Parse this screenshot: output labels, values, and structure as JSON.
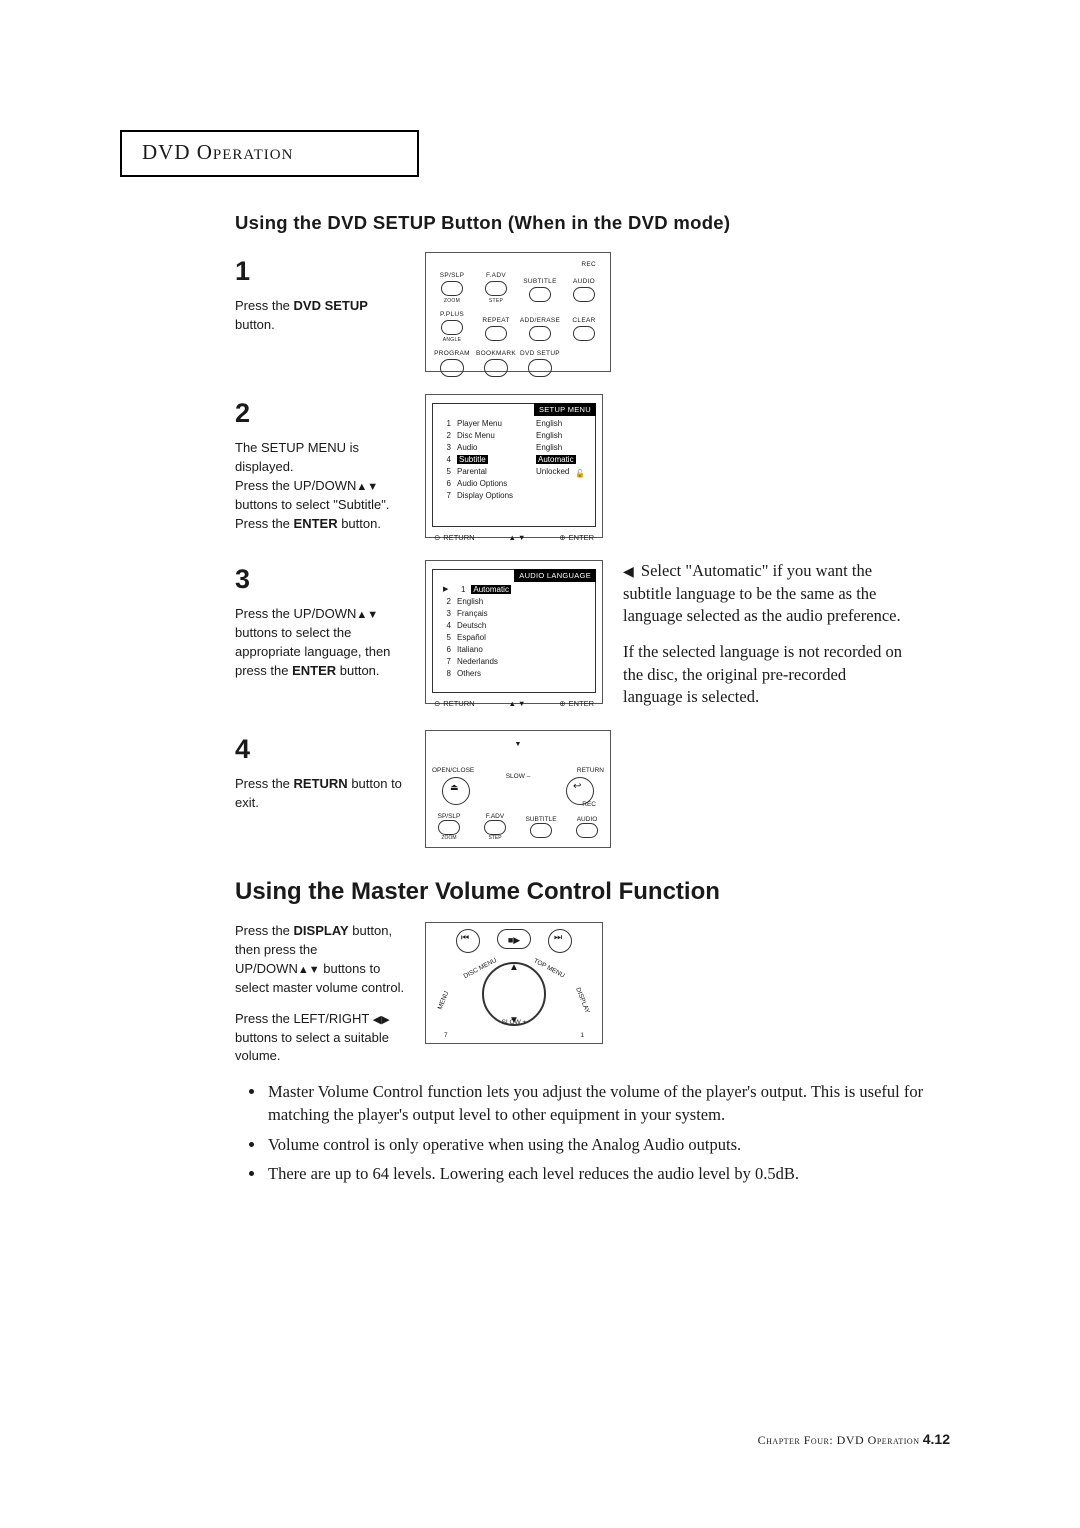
{
  "header": "DVD Operation",
  "section1_title": "Using the DVD SETUP Button (When in the DVD mode)",
  "step1": {
    "num": "1",
    "text_pre": "Press the ",
    "bold": "DVD SETUP",
    "text_post": " button.",
    "remote": {
      "rec": "REC",
      "row1": [
        "SP/SLP",
        "F.ADV",
        "SUBTITLE",
        "AUDIO"
      ],
      "zoom": "ZOOM",
      "step": "STEP",
      "row2": [
        "P.PLUS",
        "REPEAT",
        "ADD/ERASE",
        "CLEAR"
      ],
      "angle": "ANGLE",
      "row3": [
        "PROGRAM",
        "BOOKMARK",
        "DVD SETUP"
      ]
    }
  },
  "step2": {
    "num": "2",
    "l1": "The SETUP MENU is displayed.",
    "l2a": "Press the UP/DOWN",
    "l2b": " buttons to select \"Subtitle\".",
    "l3a": "Press the ",
    "l3bold": "ENTER",
    "l3b": " button.",
    "menu": {
      "title": "SETUP MENU",
      "items": [
        {
          "n": "1",
          "label": "Player Menu",
          "val": "English"
        },
        {
          "n": "2",
          "label": "Disc Menu",
          "val": "English"
        },
        {
          "n": "3",
          "label": "Audio",
          "val": "English"
        },
        {
          "n": "4",
          "label": "Subtitle",
          "val": "Automatic",
          "hi": true
        },
        {
          "n": "5",
          "label": "Parental",
          "val": "Unlocked",
          "lock": true
        },
        {
          "n": "6",
          "label": "Audio Options",
          "val": ""
        },
        {
          "n": "7",
          "label": "Display Options",
          "val": ""
        }
      ],
      "return": "RETURN",
      "enter": "ENTER"
    }
  },
  "step3": {
    "num": "3",
    "l1a": "Press the UP/DOWN",
    "l1b": " buttons to select the appropriate language, then press the ",
    "l1bold": "ENTER",
    "l1c": " button.",
    "menu": {
      "title": "AUDIO LANGUAGE",
      "items": [
        {
          "n": "1",
          "label": "Automatic",
          "ptr": true,
          "hi": true
        },
        {
          "n": "2",
          "label": "English"
        },
        {
          "n": "3",
          "label": "Français"
        },
        {
          "n": "4",
          "label": "Deutsch"
        },
        {
          "n": "5",
          "label": "Español"
        },
        {
          "n": "6",
          "label": "Italiano"
        },
        {
          "n": "7",
          "label": "Nederlands"
        },
        {
          "n": "8",
          "label": "Others"
        }
      ],
      "return": "RETURN",
      "enter": "ENTER"
    },
    "note_p1": " Select \"Automatic\" if you want the subtitle language to be the same as the language selected as the audio preference.",
    "note_p2": "If the selected language is not recorded on the disc, the original pre-recorded language is selected."
  },
  "step4": {
    "num": "4",
    "l1a": "Press the ",
    "l1bold": "RETURN",
    "l1b": " button to exit.",
    "remote": {
      "open": "OPEN/CLOSE",
      "return": "RETURN",
      "slow": "SLOW –",
      "rec": "REC",
      "row": [
        "SP/SLP",
        "F.ADV",
        "SUBTITLE",
        "AUDIO"
      ],
      "zoom": "ZOOM",
      "step": "STEP"
    }
  },
  "section2_title": "Using the Master Volume Control Function",
  "vol": {
    "p1a": "Press the ",
    "p1bold": "DISPLAY",
    "p1b": " button, then press the UP/DOWN",
    "p1c": " buttons to select master volume control.",
    "p2a": "Press the LEFT/RIGHT ",
    "p2b": " buttons to select a suitable volume.",
    "remote": {
      "disc": "DISC MENU",
      "top": "TOP MENU",
      "menu": "MENU",
      "display": "DISPLAY",
      "slowp": "SLOW +"
    }
  },
  "bullets": [
    "Master Volume Control function lets you adjust the volume of the player's output. This is useful for matching the player's output level to other equipment in your system.",
    "Volume control is only operative when using the Analog Audio outputs.",
    "There are up to 64 levels. Lowering each level reduces the audio level by 0.5dB."
  ],
  "footer": {
    "chapter": "Chapter Four: DVD Operation",
    "page": "4.12"
  }
}
